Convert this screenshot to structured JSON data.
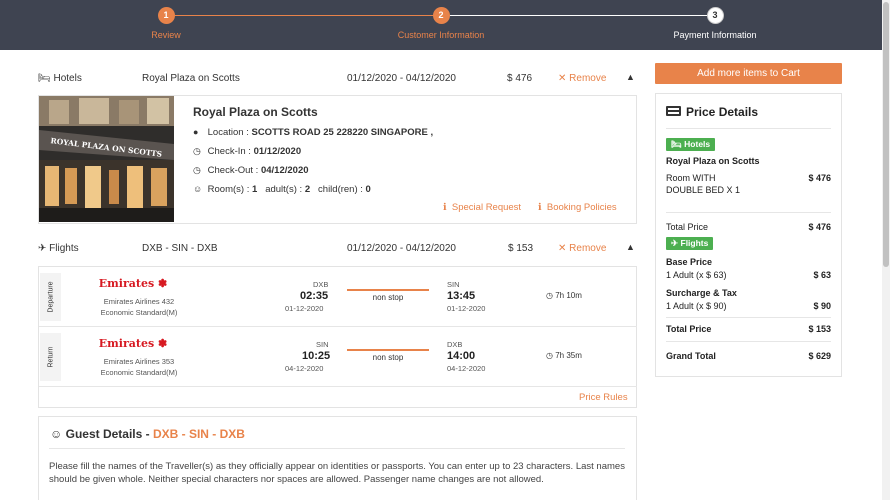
{
  "stepper": {
    "steps": [
      {
        "num": "1",
        "label": "Review"
      },
      {
        "num": "2",
        "label": "Customer Information"
      },
      {
        "num": "3",
        "label": "Payment Information"
      }
    ]
  },
  "hotels_row": {
    "label": "Hotels",
    "name": "Royal Plaza on Scotts",
    "dates": "01/12/2020 - 04/12/2020",
    "price": "$ 476",
    "remove": "Remove"
  },
  "hotel": {
    "title": "Royal Plaza on Scotts",
    "image_sign": "ROYAL PLAZA ON SCOTTS",
    "location_label": "Location : ",
    "location_value": "SCOTTS ROAD 25 228220 SINGAPORE ,",
    "checkin_label": "Check-In : ",
    "checkin_value": "01/12/2020",
    "checkout_label": "Check-Out : ",
    "checkout_value": "04/12/2020",
    "rooms_label": "Room(s) : ",
    "rooms_value": "1",
    "adults_label": "adult(s) : ",
    "adults_value": "2",
    "children_label": "child(ren) : ",
    "children_value": "0",
    "special_request": "Special Request",
    "booking_policies": "Booking Policies"
  },
  "flights_row": {
    "label": "Flights",
    "route": "DXB - SIN - DXB",
    "dates": "01/12/2020 - 04/12/2020",
    "price": "$ 153",
    "remove": "Remove"
  },
  "flights": [
    {
      "tag": "Departure",
      "airline_logo": "Emirates",
      "airline": "Emirates Airlines 432",
      "cabin": "Economic Standard(M)",
      "from_city": "DXB",
      "from_time": "02:35",
      "from_date": "01-12-2020",
      "stop": "non stop",
      "to_city": "SIN",
      "to_time": "13:45",
      "to_date": "01-12-2020",
      "duration": "7h 10m"
    },
    {
      "tag": "Return",
      "airline_logo": "Emirates",
      "airline": "Emirates Airlines 353",
      "cabin": "Economic Standard(M)",
      "from_city": "SIN",
      "from_time": "10:25",
      "from_date": "04-12-2020",
      "stop": "non stop",
      "to_city": "DXB",
      "to_time": "14:00",
      "to_date": "04-12-2020",
      "duration": "7h 35m"
    }
  ],
  "price_rules": "Price Rules",
  "guest": {
    "title": "Guest Details - ",
    "route": "DXB - SIN - DXB",
    "text": "Please fill the names of the Traveller(s) as they officially appear on identities or passports. You can enter up to 23 characters. Last names should be given whole. Neither special characters nor spaces are allowed. Passenger name changes are not allowed."
  },
  "cart": {
    "add_button": "Add more items to Cart",
    "title": "Price Details",
    "hotels_badge": "Hotels",
    "hotel_name": "Royal Plaza on Scotts",
    "room_line1": "Room WITH",
    "room_line2": "DOUBLE BED X 1",
    "room_price": "$ 476",
    "total_price_label": "Total Price",
    "total_price_value": "$ 476",
    "flights_badge": "Flights",
    "base_price_label": "Base Price",
    "base_line": "1 Adult (x $ 63)",
    "base_value": "$ 63",
    "surcharge_label": "Surcharge & Tax",
    "surcharge_line": "1 Adult (x $ 90)",
    "surcharge_value": "$ 90",
    "flight_total_label": "Total Price",
    "flight_total_value": "$ 153",
    "grand_total_label": "Grand Total",
    "grand_total_value": "$ 629"
  },
  "colors": {
    "header_bg": "#3f4451",
    "accent": "#e8834a",
    "badge_green": "#4caf50",
    "emirates_red": "#d71921"
  }
}
